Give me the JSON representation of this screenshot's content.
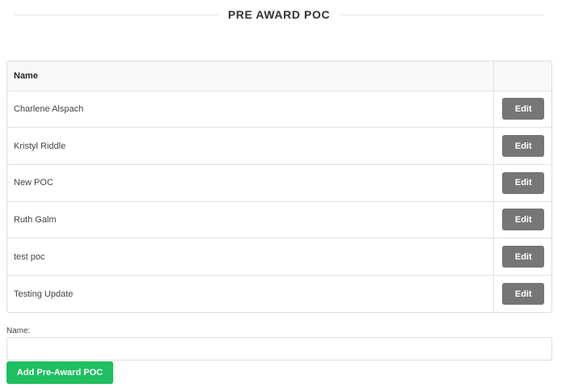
{
  "section": {
    "title": "PRE AWARD POC"
  },
  "table": {
    "headers": [
      "Name",
      ""
    ],
    "rows": [
      {
        "name": "Charlene Alspach",
        "action": "Edit"
      },
      {
        "name": "Kristyl Riddle",
        "action": "Edit"
      },
      {
        "name": "New POC",
        "action": "Edit"
      },
      {
        "name": "Ruth Galm",
        "action": "Edit"
      },
      {
        "name": "test poc",
        "action": "Edit"
      },
      {
        "name": "Testing Update",
        "action": "Edit"
      }
    ]
  },
  "form": {
    "name_label": "Name:",
    "name_value": "",
    "add_button_label": "Add Pre-Award POC"
  },
  "colors": {
    "edit_button": "#767676",
    "add_button": "#1fbf62",
    "header_bg": "#f8f8f8",
    "border": "#dddddd"
  }
}
